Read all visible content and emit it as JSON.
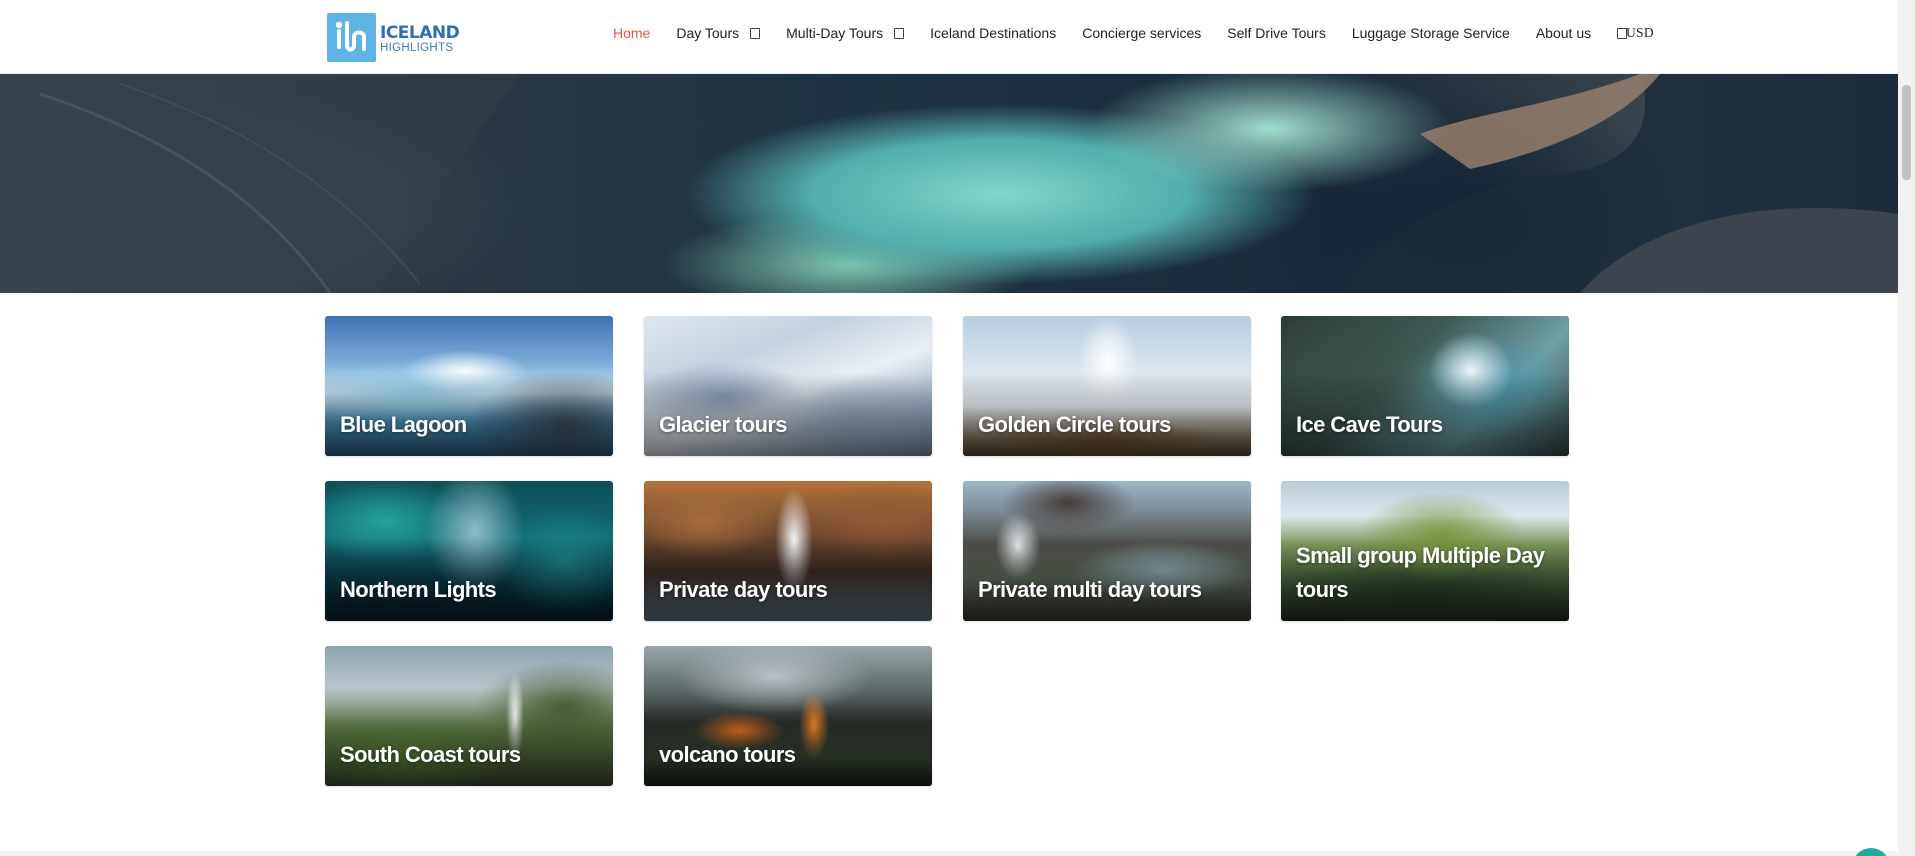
{
  "brand": {
    "logo_line1": "ICELAND",
    "logo_line2": "HIGHLIGHTS",
    "primary_color": "#2f6fb2",
    "logo_color": "#5fb4e3"
  },
  "nav": {
    "active_color": "#e8554e",
    "items": [
      {
        "label": "Home"
      },
      {
        "label": "Day Tours",
        "icon": "dropdown-icon"
      },
      {
        "label": "Multi-Day Tours",
        "icon": "dropdown-icon"
      },
      {
        "label": "Iceland Destinations"
      },
      {
        "label": "Concierge services"
      },
      {
        "label": "Self Drive Tours"
      },
      {
        "label": "Luggage Storage Service"
      },
      {
        "label": "About us"
      }
    ],
    "search_icon": "search-icon",
    "currency": "USD"
  },
  "categories": [
    {
      "label": "Blue Lagoon"
    },
    {
      "label": "Glacier tours"
    },
    {
      "label": "Golden Circle tours"
    },
    {
      "label": "Ice Cave Tours"
    },
    {
      "label": "Northern Lights"
    },
    {
      "label": "Private day tours"
    },
    {
      "label": "Private multi day tours"
    },
    {
      "label": "Small group Multiple Day tours"
    },
    {
      "label": "South Coast tours"
    },
    {
      "label": "volcano tours"
    }
  ],
  "chat": {
    "icon": "chat-icon",
    "color": "#23a99c"
  }
}
